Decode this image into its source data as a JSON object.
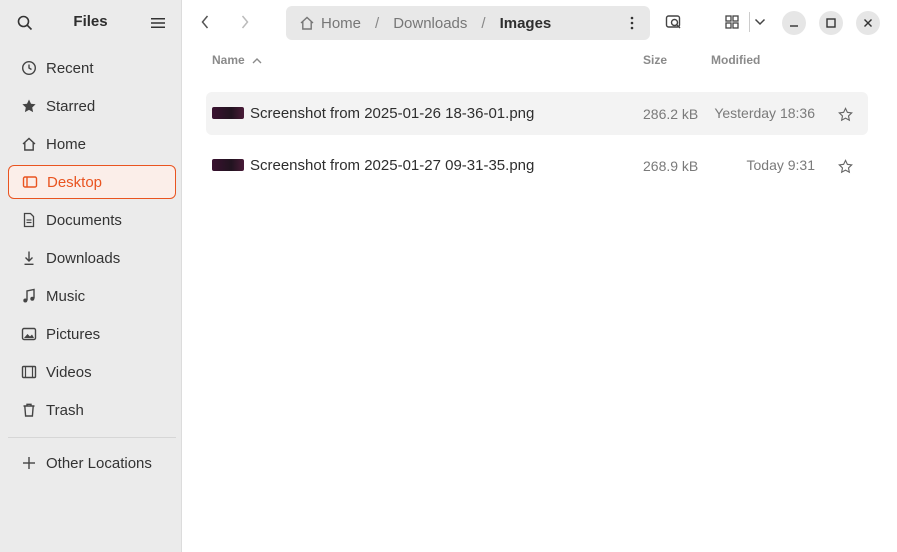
{
  "sidebar": {
    "title": "Files",
    "icons": {
      "search": "search-icon",
      "menu": "hamburger-menu-icon"
    },
    "items": [
      {
        "label": "Recent",
        "icon": "clock-icon",
        "active": false
      },
      {
        "label": "Starred",
        "icon": "star-icon",
        "active": false
      },
      {
        "label": "Home",
        "icon": "home-icon",
        "active": false
      },
      {
        "label": "Desktop",
        "icon": "desktop-icon",
        "active": true
      },
      {
        "label": "Documents",
        "icon": "document-icon",
        "active": false
      },
      {
        "label": "Downloads",
        "icon": "download-icon",
        "active": false
      },
      {
        "label": "Music",
        "icon": "music-icon",
        "active": false
      },
      {
        "label": "Pictures",
        "icon": "picture-icon",
        "active": false
      },
      {
        "label": "Videos",
        "icon": "video-icon",
        "active": false
      },
      {
        "label": "Trash",
        "icon": "trash-icon",
        "active": false
      }
    ],
    "other_locations": "Other Locations"
  },
  "header": {
    "breadcrumbs": [
      {
        "label": "Home",
        "icon": "home-icon"
      },
      {
        "label": "Downloads"
      },
      {
        "label": "Images",
        "current": true
      }
    ]
  },
  "columns": {
    "name": "Name",
    "size": "Size",
    "modified": "Modified"
  },
  "files": [
    {
      "name": "Screenshot from 2025-01-26 18-36-01.png",
      "size": "286.2 kB",
      "modified": "Yesterday 18:36"
    },
    {
      "name": "Screenshot from 2025-01-27 09-31-35.png",
      "size": "268.9 kB",
      "modified": "Today 9:31"
    }
  ],
  "colors": {
    "accent": "#e95420",
    "sidebar_bg": "#ebebeb",
    "window_bg": "#ffffff"
  }
}
